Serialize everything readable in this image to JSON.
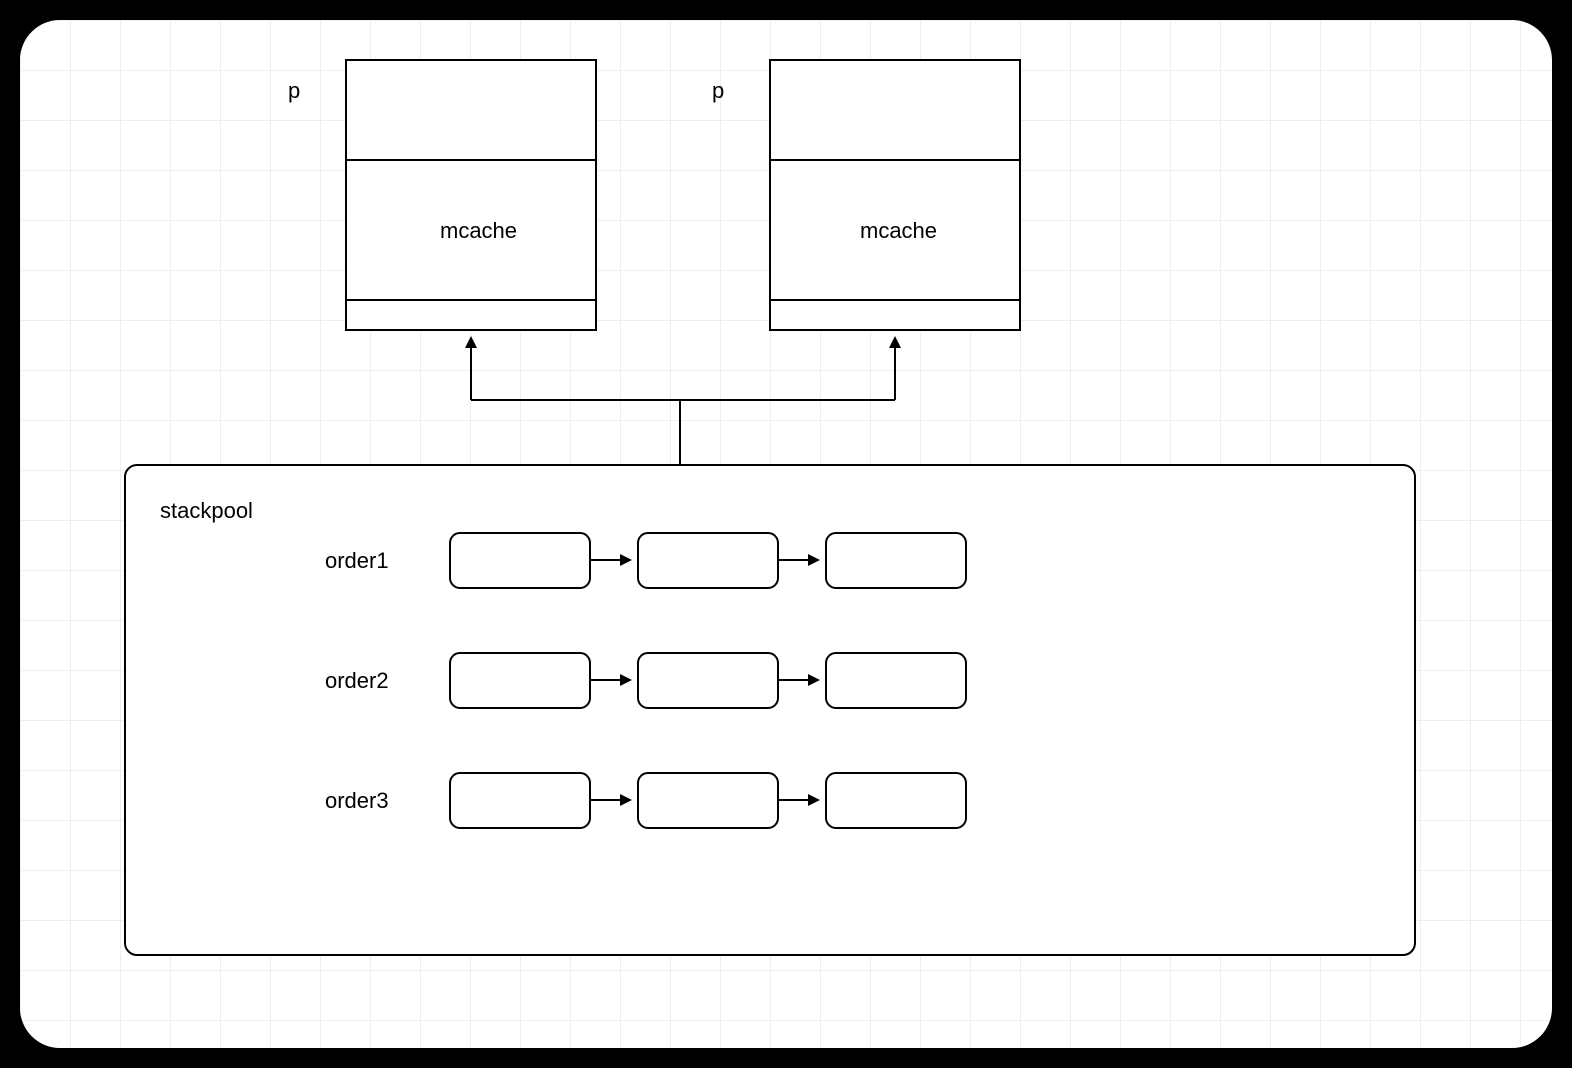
{
  "p_boxes": [
    {
      "label": "p",
      "mcache": "mcache"
    },
    {
      "label": "p",
      "mcache": "mcache"
    }
  ],
  "stackpool": {
    "title": "stackpool",
    "orders": [
      "order1",
      "order2",
      "order3"
    ]
  }
}
